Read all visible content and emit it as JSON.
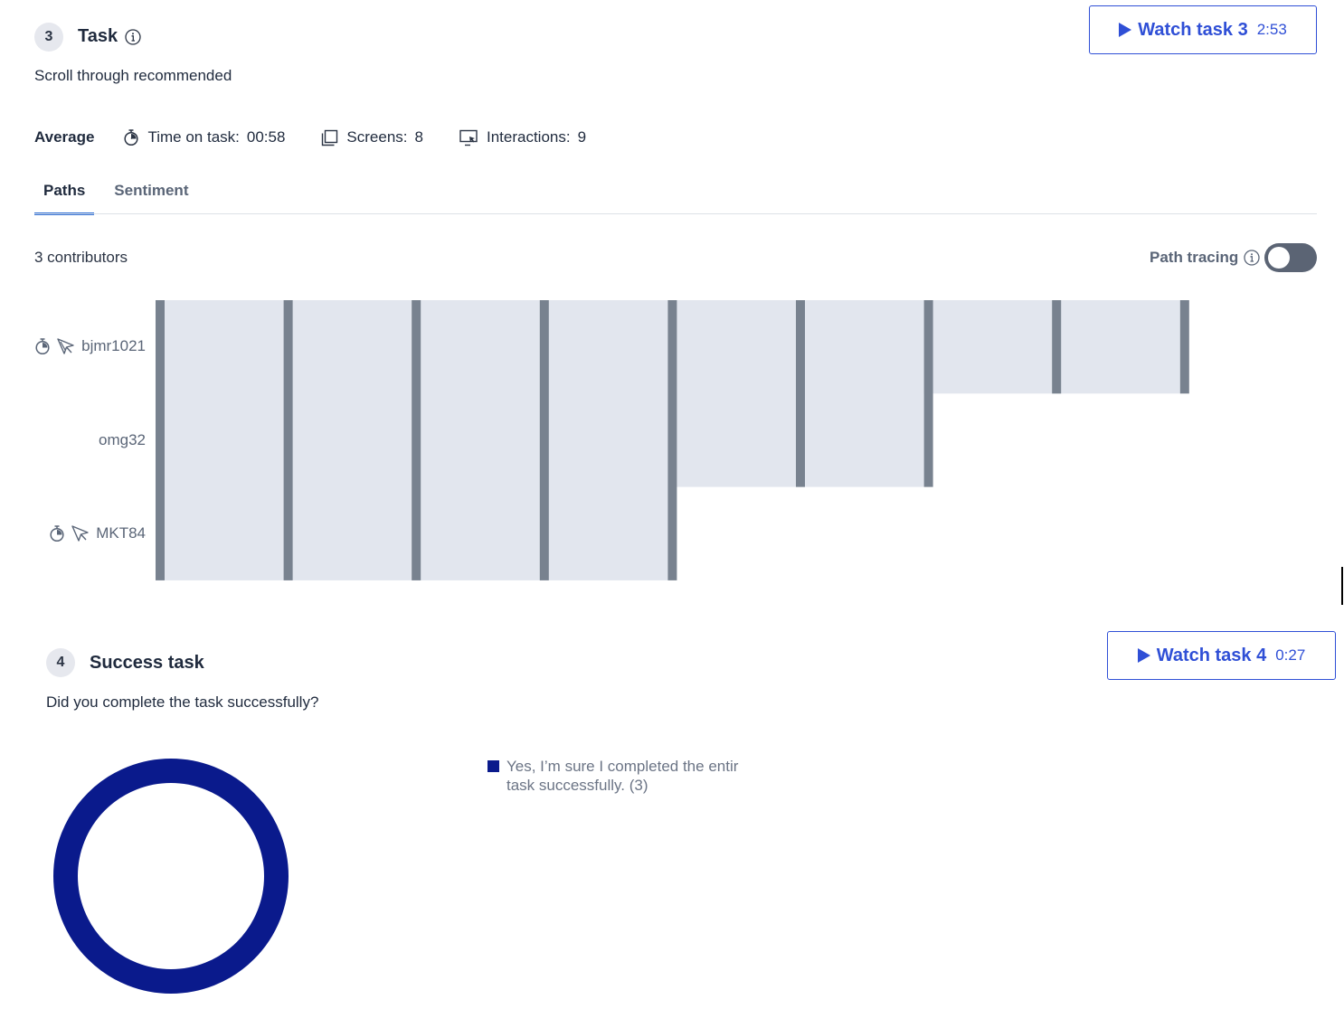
{
  "task3": {
    "number": "3",
    "title": "Task",
    "description": "Scroll through recommended",
    "watch_label": "Watch task 3",
    "watch_duration": "2:53",
    "metrics": {
      "average_label": "Average",
      "time_label": "Time on task:",
      "time_value": "00:58",
      "screens_label": "Screens:",
      "screens_value": "8",
      "interactions_label": "Interactions:",
      "interactions_value": "9"
    },
    "tabs": [
      {
        "label": "Paths",
        "active": true
      },
      {
        "label": "Sentiment",
        "active": false
      }
    ],
    "contributors": "3 contributors",
    "path_tracing_label": "Path tracing",
    "path_tracing_on": false,
    "users": [
      {
        "name": "bjmr1021",
        "icons": [
          "stopwatch-icon",
          "cursor-arrow-icon"
        ],
        "screens": 9
      },
      {
        "name": "omg32",
        "icons": [],
        "screens": 7
      },
      {
        "name": "MKT84",
        "icons": [
          "stopwatch-icon",
          "cursor-arrow-icon"
        ],
        "screens": 5
      }
    ],
    "colors": {
      "path_fill": "#e2e6ee",
      "path_divider": "#78828f",
      "accent": "#2f4fd6"
    }
  },
  "task4": {
    "number": "4",
    "title": "Success task",
    "description": "Did you complete the task successfully?",
    "watch_label": "Watch task 4",
    "watch_duration": "0:27",
    "legend_text": "Yes, I’m sure I completed the entir task successfully. (3)",
    "legend_color": "#0a1a8c"
  },
  "chart_data": {
    "type": "pie",
    "categories": [
      "Yes, I’m sure I completed the entir task successfully."
    ],
    "values": [
      3
    ],
    "colors": [
      "#0a1a8c"
    ]
  }
}
